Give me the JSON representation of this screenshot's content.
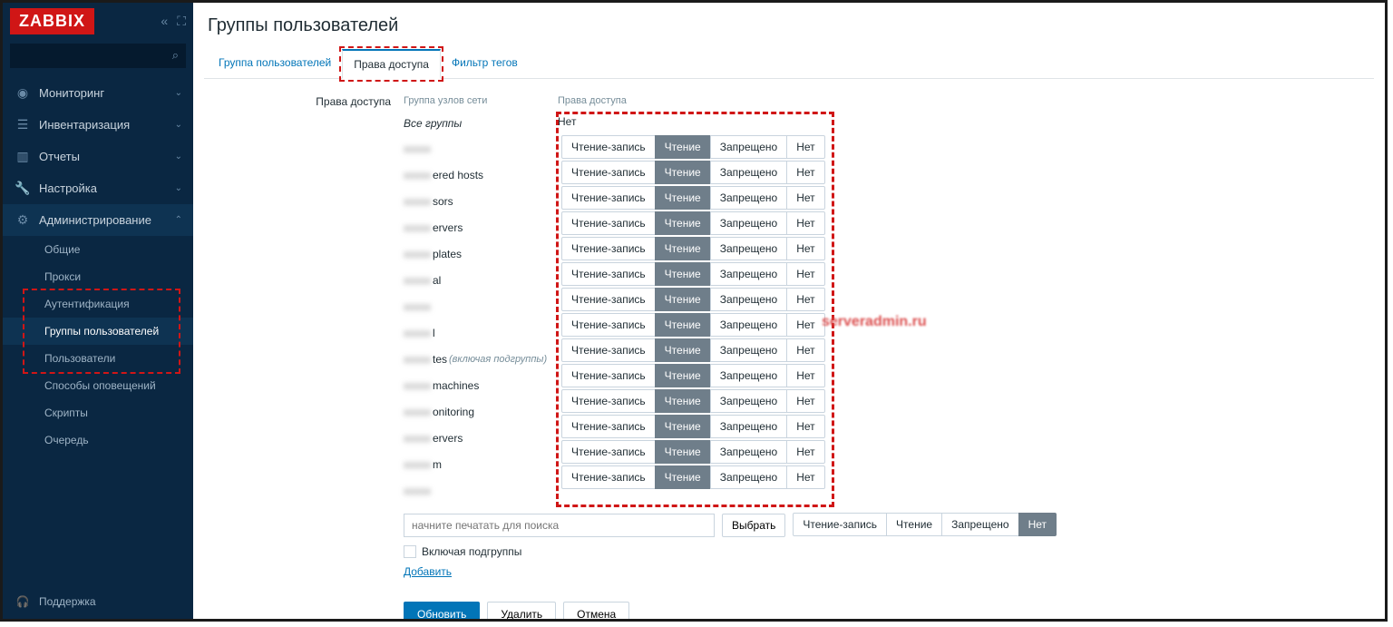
{
  "brand": "ZABBIX",
  "page_title": "Группы пользователей",
  "tabs": {
    "t1": "Группа пользователей",
    "t2": "Права доступа",
    "t3": "Фильтр тегов"
  },
  "form_label_perm": "Права доступа",
  "col_head_group": "Группа узлов сети",
  "col_head_rights": "Права доступа",
  "all_groups_label": "Все группы",
  "all_groups_value": "Нет",
  "perm_options": {
    "rw": "Чтение-запись",
    "r": "Чтение",
    "deny": "Запрещено",
    "none": "Нет"
  },
  "groups": [
    {
      "blur": "xxxxx",
      "suffix": ""
    },
    {
      "blur": "xxxxx",
      "suffix": "ered hosts"
    },
    {
      "blur": "xxxxx",
      "suffix": "sors"
    },
    {
      "blur": "xxxxx",
      "suffix": "ervers"
    },
    {
      "blur": "xxxxx",
      "suffix": "plates"
    },
    {
      "blur": "xxxxx",
      "suffix": "al"
    },
    {
      "blur": "xxxxx",
      "suffix": ""
    },
    {
      "blur": "xxxxx",
      "suffix": "l"
    },
    {
      "blur": "xxxxx",
      "suffix": "tes",
      "ital": "(включая подгруппы)"
    },
    {
      "blur": "xxxxx",
      "suffix": "machines"
    },
    {
      "blur": "xxxxx",
      "suffix": "onitoring"
    },
    {
      "blur": "xxxxx",
      "suffix": "ervers"
    },
    {
      "blur": "xxxxx",
      "suffix": "m"
    },
    {
      "blur": "xxxxx",
      "suffix": ""
    }
  ],
  "search_placeholder": "начните печатать для поиска",
  "btn_select": "Выбрать",
  "chk_include": "Включая подгруппы",
  "link_add": "Добавить",
  "btn_update": "Обновить",
  "btn_delete": "Удалить",
  "btn_cancel": "Отмена",
  "nav": {
    "monitoring": "Мониторинг",
    "inventory": "Инвентаризация",
    "reports": "Отчеты",
    "config": "Настройка",
    "admin": "Администрирование"
  },
  "admin_sub": {
    "general": "Общие",
    "proxy": "Прокси",
    "auth": "Аутентификация",
    "usergroups": "Группы пользователей",
    "users": "Пользователи",
    "media": "Способы оповещений",
    "scripts": "Скрипты",
    "queue": "Очередь"
  },
  "support": "Поддержка",
  "watermark": "serveradmin.ru"
}
